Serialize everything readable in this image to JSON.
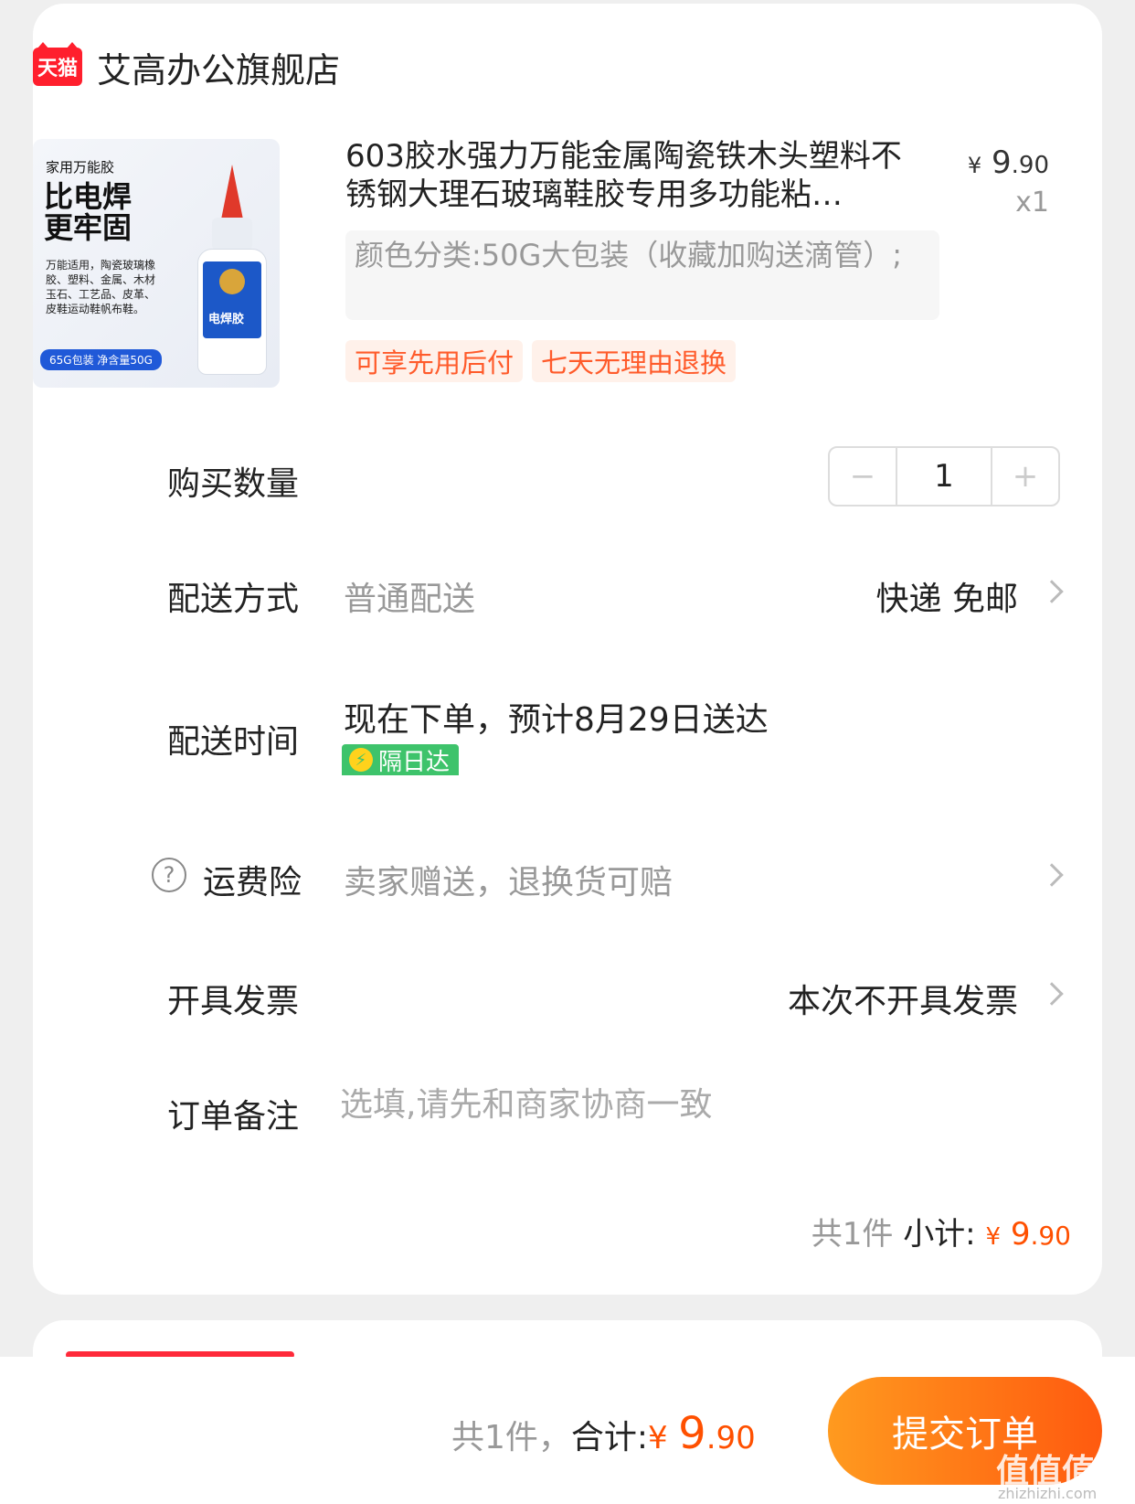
{
  "shop": {
    "platform_logo": "天猫",
    "name": "艾高办公旗舰店"
  },
  "product": {
    "image": {
      "headline_small": "家用万能胶",
      "headline_big": "比电焊更牢固",
      "desc": "万能适用，陶瓷玻璃橡胶、塑料、金属、木材玉石、工艺品、皮革、皮鞋运动鞋帆布鞋。",
      "badge": "65G包装 净含量50G",
      "bottle_label": "电焊胶"
    },
    "title": "603胶水强力万能金属陶瓷铁木头塑料不锈钢大理石玻璃鞋胶专用多功能粘…",
    "price_symbol": "¥",
    "price_int": "9",
    "price_dec": ".90",
    "quantity_label": "x1",
    "spec": "颜色分类:50G大包装（收藏加购送滴管）;",
    "tags": [
      "可享先用后付",
      "七天无理由退换"
    ]
  },
  "purchase_qty": {
    "label": "购买数量",
    "minus": "−",
    "value": "1",
    "plus": "+"
  },
  "delivery_method": {
    "label": "配送方式",
    "value": "普通配送",
    "right": "快递 免邮"
  },
  "delivery_time": {
    "label": "配送时间",
    "value": "现在下单，预计8月29日送达",
    "badge": "隔日达"
  },
  "shipping_insurance": {
    "icon_text": "?",
    "label": "运费险",
    "value": "卖家赠送，退换货可赔"
  },
  "invoice": {
    "label": "开具发票",
    "value": "本次不开具发票"
  },
  "remark": {
    "label": "订单备注",
    "placeholder": "选填,请先和商家协商一致"
  },
  "subtotal": {
    "count": "共1件",
    "label": "小计:",
    "symbol": "¥",
    "int": "9",
    "dec": ".90"
  },
  "footer": {
    "count": "共1件，",
    "label": "合计:",
    "symbol": "¥",
    "int": "9",
    "dec": ".90",
    "submit": "提交订单"
  },
  "watermark": {
    "main": "值值值",
    "sub": "zhizhizhi.com"
  },
  "colors": {
    "accent": "#ff5000",
    "tag_bg": "#fff1ea",
    "tag_text": "#ff5b2b",
    "submit_from": "#ff9a1f",
    "submit_to": "#ff5a0f",
    "next_day": "#3ec36b"
  }
}
